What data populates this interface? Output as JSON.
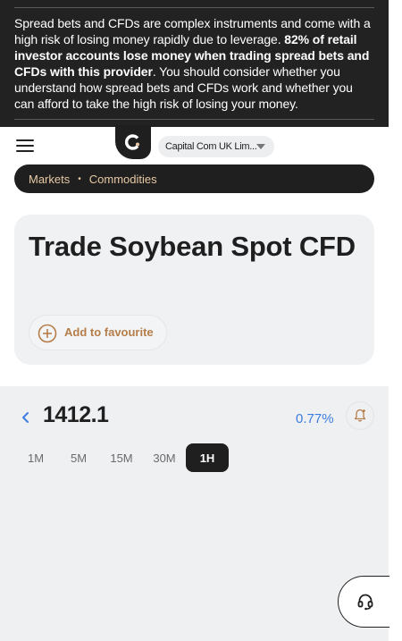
{
  "risk_warning": {
    "part1": "Spread bets and CFDs are complex instruments and come with a high risk of losing money rapidly due to leverage. ",
    "bold": "82% of retail investor accounts lose money when trading spread bets and CFDs with this provider",
    "part2": ". You should consider whether you understand how spread bets and CFDs work and whether you can afford to take the high risk of losing your money."
  },
  "header": {
    "entity_label": "Capital Com UK Lim..."
  },
  "breadcrumb": {
    "items": [
      "Markets",
      "Commodities"
    ],
    "separator": "•"
  },
  "instrument": {
    "title": "Trade Soybean Spot CFD",
    "favourite_label": "Add to favourite"
  },
  "chart": {
    "price": "1412.1",
    "change": "0.77%",
    "timeframes": [
      "1M",
      "5M",
      "15M",
      "30M",
      "1H"
    ],
    "active_timeframe": "1H"
  },
  "colors": {
    "accent": "#b57d49",
    "breadcrumb_text": "#e8c9a4",
    "change_positive": "#3d7ce0",
    "dark": "#1f1f1f"
  },
  "icons": {
    "menu": "hamburger-icon",
    "logo": "capital-com-logo",
    "favourite": "plus-circle-icon",
    "back": "chevron-left-icon",
    "alert": "bell-icon",
    "support": "headset-icon"
  }
}
